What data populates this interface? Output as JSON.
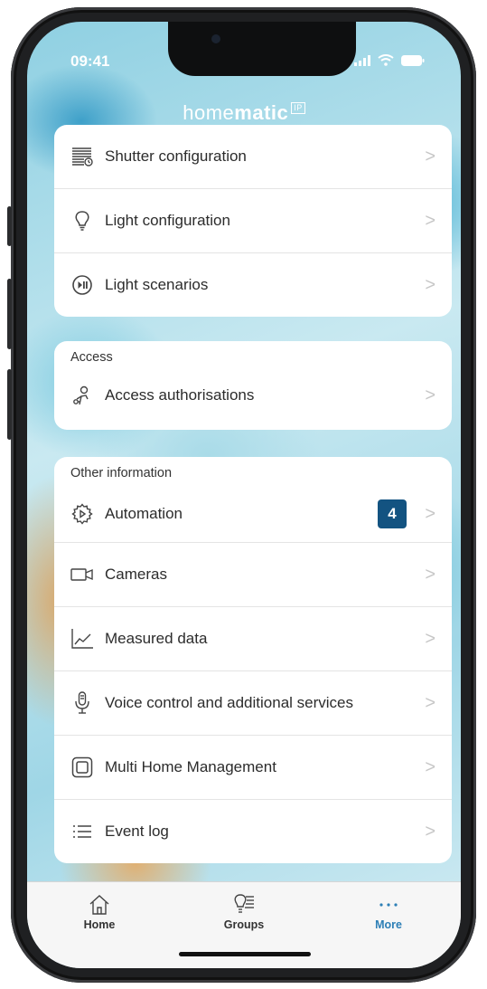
{
  "status_bar": {
    "time": "09:41"
  },
  "app": {
    "brand_light": "home",
    "brand_bold": "matic",
    "brand_badge": "IP"
  },
  "card_top": {
    "items": [
      {
        "label": "Shutter configuration",
        "icon": "shutter-icon"
      },
      {
        "label": "Light configuration",
        "icon": "lightbulb-icon"
      },
      {
        "label": "Light scenarios",
        "icon": "play-pause-icon"
      }
    ]
  },
  "card_access": {
    "heading": "Access",
    "items": [
      {
        "label": "Access authorisations",
        "icon": "key-person-icon"
      }
    ]
  },
  "card_other": {
    "heading": "Other information",
    "items": [
      {
        "label": "Automation",
        "icon": "gear-play-icon",
        "badge": "4"
      },
      {
        "label": "Cameras",
        "icon": "camera-icon"
      },
      {
        "label": "Measured data",
        "icon": "chart-icon"
      },
      {
        "label": "Voice control and additional services",
        "icon": "microphone-icon"
      },
      {
        "label": "Multi Home Management",
        "icon": "multi-home-icon"
      },
      {
        "label": "Event log",
        "icon": "list-icon"
      }
    ]
  },
  "chevron": ">",
  "tabbar": {
    "tabs": [
      {
        "label": "Home",
        "icon": "house-icon",
        "active": false
      },
      {
        "label": "Groups",
        "icon": "groups-icon",
        "active": false
      },
      {
        "label": "More",
        "icon": "more-dots-icon",
        "active": true
      }
    ]
  },
  "colors": {
    "badge": "#135381",
    "active_tab": "#2d7fb6"
  }
}
